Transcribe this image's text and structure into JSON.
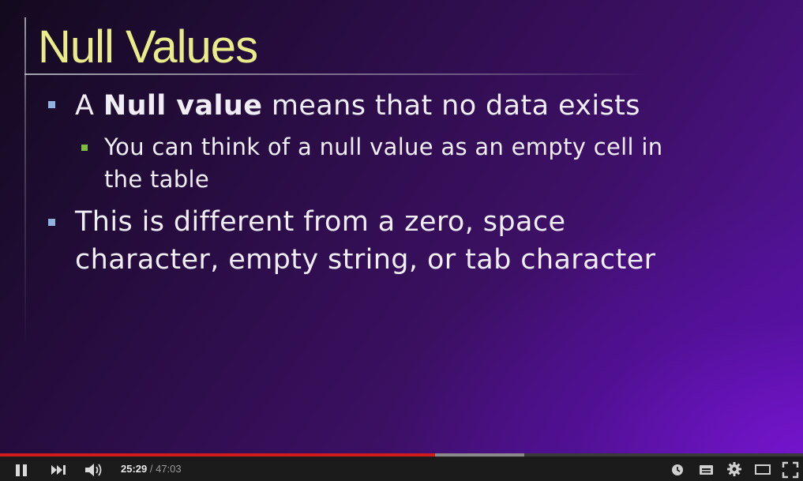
{
  "slide": {
    "title": "Null Values",
    "bullets": {
      "b1_prefix": "A ",
      "b1_bold": "Null value",
      "b1_suffix": " means that no data exists",
      "b1_sub_line1": "You can think of a null value as an empty cell in",
      "b1_sub_line2": "the table",
      "b2_line1": "This is different from a zero, space",
      "b2_line2": "character, empty string, or tab character"
    }
  },
  "player": {
    "current_time": "25:29",
    "separator": " / ",
    "duration": "47:03",
    "progress_fraction": 0.5415,
    "buffered_fraction": 0.6527,
    "icons": {
      "play_pause": "pause-icon",
      "next": "next-icon",
      "volume": "volume-icon",
      "watch_later": "clock-icon",
      "captions": "captions-icon",
      "settings": "gear-icon",
      "theater": "theater-mode-icon",
      "fullscreen": "fullscreen-icon"
    },
    "colors": {
      "played": "#d21c1c",
      "buffered": "#8a8a8a",
      "bar": "#1b1b1b"
    }
  }
}
